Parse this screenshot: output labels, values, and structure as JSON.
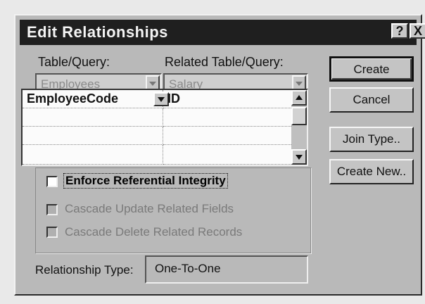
{
  "window": {
    "title": "Edit Relationships",
    "help_glyph": "?",
    "close_glyph": "X"
  },
  "labels": {
    "table_query": "Table/Query:",
    "related_table_query": "Related Table/Query:",
    "relationship_type": "Relationship Type:"
  },
  "combos": {
    "table_value": "Employees",
    "related_value": "Salary"
  },
  "grid": {
    "rows": [
      {
        "left": "EmployeeCode",
        "right": "ID"
      },
      {
        "left": "",
        "right": ""
      },
      {
        "left": "",
        "right": ""
      }
    ]
  },
  "options": {
    "enforce": "Enforce Referential Integrity",
    "cascade_update": "Cascade Update Related Fields",
    "cascade_delete": "Cascade Delete Related Records"
  },
  "relationship_type_value": "One-To-One",
  "buttons": {
    "create": "Create",
    "cancel": "Cancel",
    "join_type": "Join Type..",
    "create_new": "Create New.."
  }
}
